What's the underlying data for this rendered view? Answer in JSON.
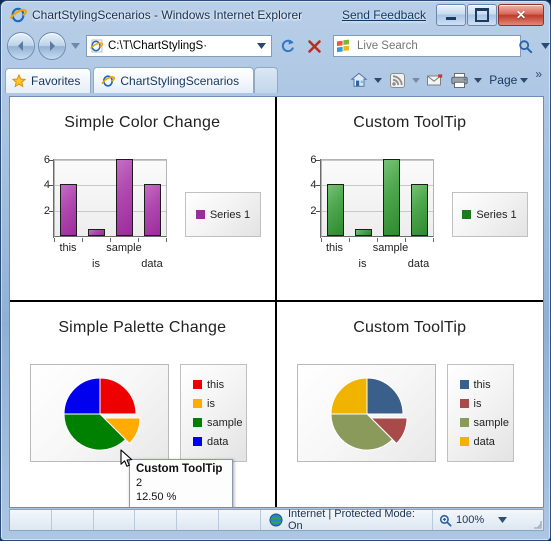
{
  "window": {
    "title": "ChartStylingScenarios - Windows Internet Explorer",
    "send_feedback": "Send Feedback",
    "minimize_label": "Minimize",
    "maximize_label": "Maximize",
    "close_label": "Close"
  },
  "nav": {
    "back_label": "Back",
    "forward_label": "Forward",
    "history_label": "Recent Pages",
    "address_value": "C:\\T\\ChartStylingS·",
    "address_dropdown_label": "Address dropdown",
    "refresh_label": "Refresh",
    "stop_label": "Stop",
    "search_placeholder": "Live Search",
    "search_value": "",
    "search_dropdown_label": "Search options"
  },
  "tabs": {
    "favorites_label": "Favorites",
    "items": [
      {
        "label": "ChartStylingScenarios",
        "active": true
      }
    ],
    "new_tab_label": "New Tab"
  },
  "commandbar": {
    "home_label": "Home",
    "feeds_label": "Feeds",
    "mail_label": "Read Mail",
    "print_label": "Print",
    "page_label": "Page",
    "more_label": "»"
  },
  "statusbar": {
    "zone_text": "Internet | Protected Mode: On",
    "zoom_text": "100%",
    "zoom_dropdown_label": "Change Zoom Level"
  },
  "tooltip": {
    "title": "Custom ToolTip",
    "value": "2",
    "percent": "12.50 %"
  },
  "chart_data": [
    {
      "type": "bar",
      "title": "Simple Color Change",
      "categories": [
        "this",
        "is",
        "sample",
        "data"
      ],
      "values": [
        4,
        2,
        6,
        4
      ],
      "series": [
        {
          "name": "Series 1",
          "values": [
            4,
            2,
            6,
            4
          ],
          "color": "#9c2b9c"
        }
      ],
      "legend": [
        "Series 1"
      ],
      "yticks": [
        2,
        4,
        6
      ],
      "ylim": [
        1.5,
        6.8
      ],
      "xlabel": "",
      "ylabel": "",
      "grid": true,
      "legend_position": "right",
      "bar_color": "#a63aa6"
    },
    {
      "type": "bar",
      "title": "Custom ToolTip",
      "categories": [
        "this",
        "is",
        "sample",
        "data"
      ],
      "values": [
        4,
        2,
        6,
        4
      ],
      "series": [
        {
          "name": "Series 1",
          "values": [
            4,
            2,
            6,
            4
          ],
          "color": "#2f8a2f"
        }
      ],
      "legend": [
        "Series 1"
      ],
      "yticks": [
        2,
        4,
        6
      ],
      "ylim": [
        1.5,
        6.8
      ],
      "xlabel": "",
      "ylabel": "",
      "grid": true,
      "legend_position": "right",
      "bar_color": "#3d9a3d"
    },
    {
      "type": "pie",
      "title": "Simple Palette Change",
      "labels": [
        "this",
        "is",
        "sample",
        "data"
      ],
      "values": [
        25,
        12.5,
        37.5,
        25
      ],
      "colors": [
        "#ee0000",
        "#ffab00",
        "#008000",
        "#0000ee"
      ],
      "exploded_index": 1,
      "legend": [
        "this",
        "is",
        "sample",
        "data"
      ],
      "legend_position": "right"
    },
    {
      "type": "pie",
      "title": "Custom ToolTip",
      "labels": [
        "this",
        "is",
        "sample",
        "data"
      ],
      "values": [
        25,
        12.5,
        37.5,
        25
      ],
      "colors": [
        "#3a5f8a",
        "#a84a4a",
        "#8a9a5b",
        "#f0b400"
      ],
      "exploded_index": 1,
      "legend": [
        "this",
        "is",
        "sample",
        "data"
      ],
      "legend_position": "right"
    }
  ]
}
